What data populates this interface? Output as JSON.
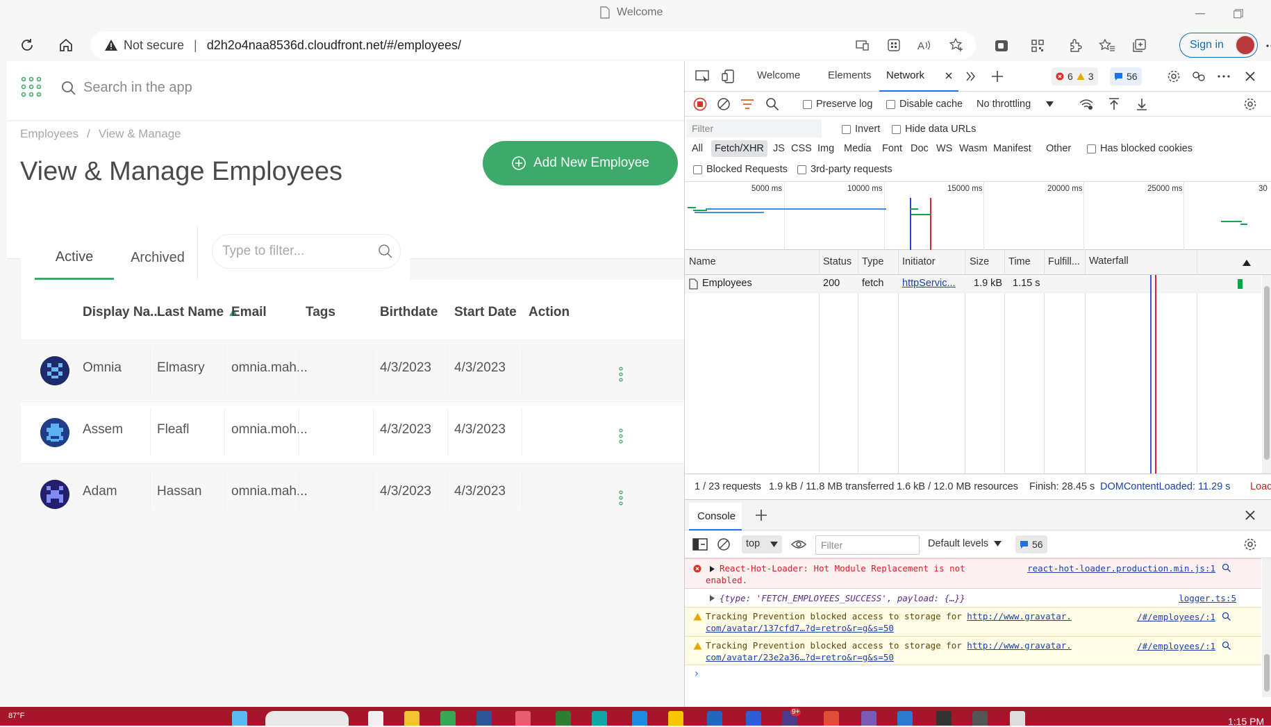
{
  "browser": {
    "window_title": "Welcome",
    "security_label": "Not secure",
    "url": "d2h2o4naa8536d.cloudfront.net/#/employees/",
    "signin_label": "Sign in"
  },
  "app": {
    "search_placeholder": "Search in the app",
    "breadcrumb": [
      "Employees",
      "View & Manage"
    ],
    "breadcrumb_sep": "/",
    "page_title": "View & Manage Employees",
    "add_button_label": "Add New Employee",
    "tabs": [
      "Active",
      "Archived"
    ],
    "filter_placeholder": "Type to filter...",
    "columns": [
      "Display Na...",
      "Last Name",
      "Email",
      "Tags",
      "Birthdate",
      "Start Date",
      "Action"
    ],
    "rows": [
      {
        "display_name": "Omnia",
        "last_name": "Elmasry",
        "email": "omnia.mah...",
        "tags": "",
        "birthdate": "4/3/2023",
        "start_date": "4/3/2023"
      },
      {
        "display_name": "Assem",
        "last_name": "Fleafl",
        "email": "omnia.moh...",
        "tags": "",
        "birthdate": "4/3/2023",
        "start_date": "4/3/2023"
      },
      {
        "display_name": "Adam",
        "last_name": "Hassan",
        "email": "omnia.mah...",
        "tags": "",
        "birthdate": "4/3/2023",
        "start_date": "4/3/2023"
      }
    ],
    "accent_color": "#3daa6a"
  },
  "devtools": {
    "tabs": [
      "Welcome",
      "Elements",
      "Network"
    ],
    "active_tab": "Network",
    "errors_count": "6",
    "warnings_count": "3",
    "messages_count": "56",
    "preserve_log": "Preserve log",
    "disable_cache": "Disable cache",
    "throttling": "No throttling",
    "filter_placeholder": "Filter",
    "invert": "Invert",
    "hide_data_urls": "Hide data URLs",
    "type_filters": [
      "All",
      "Fetch/XHR",
      "JS",
      "CSS",
      "Img",
      "Media",
      "Font",
      "Doc",
      "WS",
      "Wasm",
      "Manifest",
      "Other"
    ],
    "has_blocked_cookies": "Has blocked cookies",
    "blocked_requests": "Blocked Requests",
    "third_party": "3rd-party requests",
    "timeline_ticks": [
      "5000 ms",
      "10000 ms",
      "15000 ms",
      "20000 ms",
      "25000 ms",
      "30"
    ],
    "net_columns": [
      "Name",
      "Status",
      "Type",
      "Initiator",
      "Size",
      "Time",
      "Fulfill...",
      "Waterfall"
    ],
    "request": {
      "name": "Employees",
      "status": "200",
      "type": "fetch",
      "initiator": "httpServic...",
      "size": "1.9 kB",
      "time": "1.15 s"
    },
    "status_bar": {
      "requests": "1 / 23 requests",
      "transferred": "1.9 kB / 11.8 MB transferred",
      "resources": "1.6 kB / 12.0 MB resources",
      "finish": "Finish: 28.45 s",
      "dom_loaded": "DOMContentLoaded: 11.29 s",
      "load": "Load"
    },
    "drawer_tab": "Console",
    "console_context": "top",
    "console_filter_placeholder": "Filter",
    "console_levels": "Default levels",
    "console_msg_count": "56",
    "console_messages": [
      {
        "level": "error",
        "text1": "React-Hot-Loader: Hot Module Replacement is not",
        "text2": "enabled.",
        "source": "react-hot-loader.production.min.js:1"
      },
      {
        "level": "log",
        "text1": "{type: 'FETCH_EMPLOYEES_SUCCESS', payload: {…}}",
        "source": "logger.ts:5"
      },
      {
        "level": "warning",
        "text1": "Tracking Prevention blocked access to storage for ",
        "link1": "http://www.gravatar.",
        "link2": "com/avatar/137cfd7…?d=retro&r=g&s=50",
        "source": "/#/employees/:1"
      },
      {
        "level": "warning",
        "text1": "Tracking Prevention blocked access to storage for ",
        "link1": "http://www.gravatar.",
        "link2": "com/avatar/23e2a36…?d=retro&r=g&s=50",
        "source": "/#/employees/:1"
      }
    ],
    "prompt": "›"
  },
  "taskbar": {
    "weather": "87°F",
    "clock": "1:15 PM",
    "notification_badge": "9+",
    "color": "#a8142a"
  }
}
